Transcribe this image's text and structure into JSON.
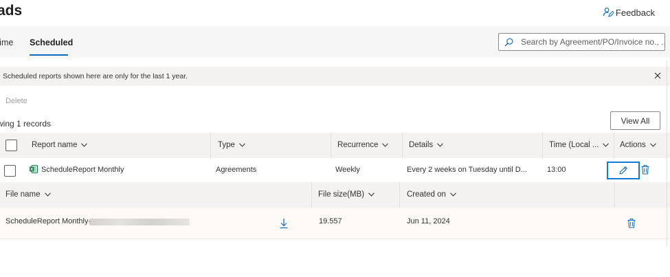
{
  "page": {
    "title": "ads"
  },
  "header": {
    "feedback_label": "Feedback"
  },
  "tabs": [
    {
      "label": "Time"
    },
    {
      "label": "Scheduled",
      "active": true
    }
  ],
  "search": {
    "placeholder": "Search by Agreement/PO/Invoice no., ..."
  },
  "banner": {
    "text": "Scheduled reports shown here are only for the last 1 year."
  },
  "toolbar": {
    "delete_label": "Delete",
    "records_text": "wing 1 records",
    "view_all_label": "View All"
  },
  "table": {
    "columns": [
      "Report name",
      "Type",
      "Recurrence",
      "Details",
      "Time (Local ...",
      "Actions"
    ],
    "rows": [
      {
        "report_name": "ScheduleReport Monthly",
        "type": "Agreements",
        "recurrence": "Weekly",
        "details": "Every 2 weeks on Tuesday until D...",
        "time": "13:00"
      }
    ]
  },
  "files": {
    "columns": [
      "File name",
      "File size(MB)",
      "Created on"
    ],
    "rows": [
      {
        "file_name_prefix": "ScheduleReport Monthly-",
        "file_size": "19.557",
        "created_on": "Jun 11, 2024"
      }
    ]
  },
  "colors": {
    "accent": "#0f6cbd",
    "excel_green": "#107c41",
    "header_bg": "#f3f2f1",
    "file_row_bg": "#fdf9f4"
  },
  "icons": [
    "feedback-icon",
    "search-icon",
    "close-icon",
    "chevron-down-icon",
    "excel-icon",
    "edit-icon",
    "trash-icon",
    "download-icon"
  ]
}
